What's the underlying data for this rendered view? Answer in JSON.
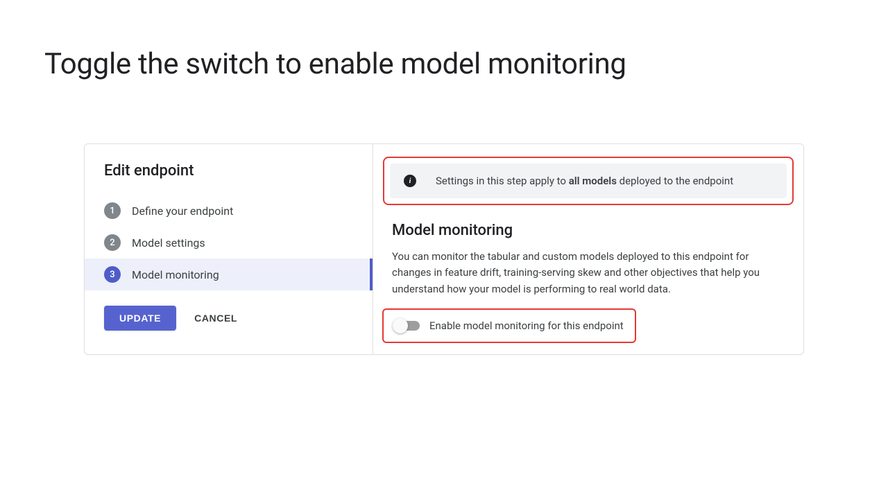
{
  "slide": {
    "title": "Toggle the switch to enable model monitoring"
  },
  "sidebar": {
    "title": "Edit endpoint",
    "steps": [
      {
        "num": "1",
        "label": "Define your endpoint"
      },
      {
        "num": "2",
        "label": "Model settings"
      },
      {
        "num": "3",
        "label": "Model monitoring"
      }
    ],
    "buttons": {
      "update": "UPDATE",
      "cancel": "CANCEL"
    }
  },
  "content": {
    "banner_prefix": "Settings in this step apply to ",
    "banner_bold": "all models",
    "banner_suffix": " deployed to the endpoint",
    "section_title": "Model monitoring",
    "section_desc": "You can monitor the tabular and custom models deployed to this endpoint for changes in feature drift, training-serving skew and other objectives that help you understand how your model is performing to real world data.",
    "toggle_label": "Enable model monitoring for this endpoint"
  }
}
